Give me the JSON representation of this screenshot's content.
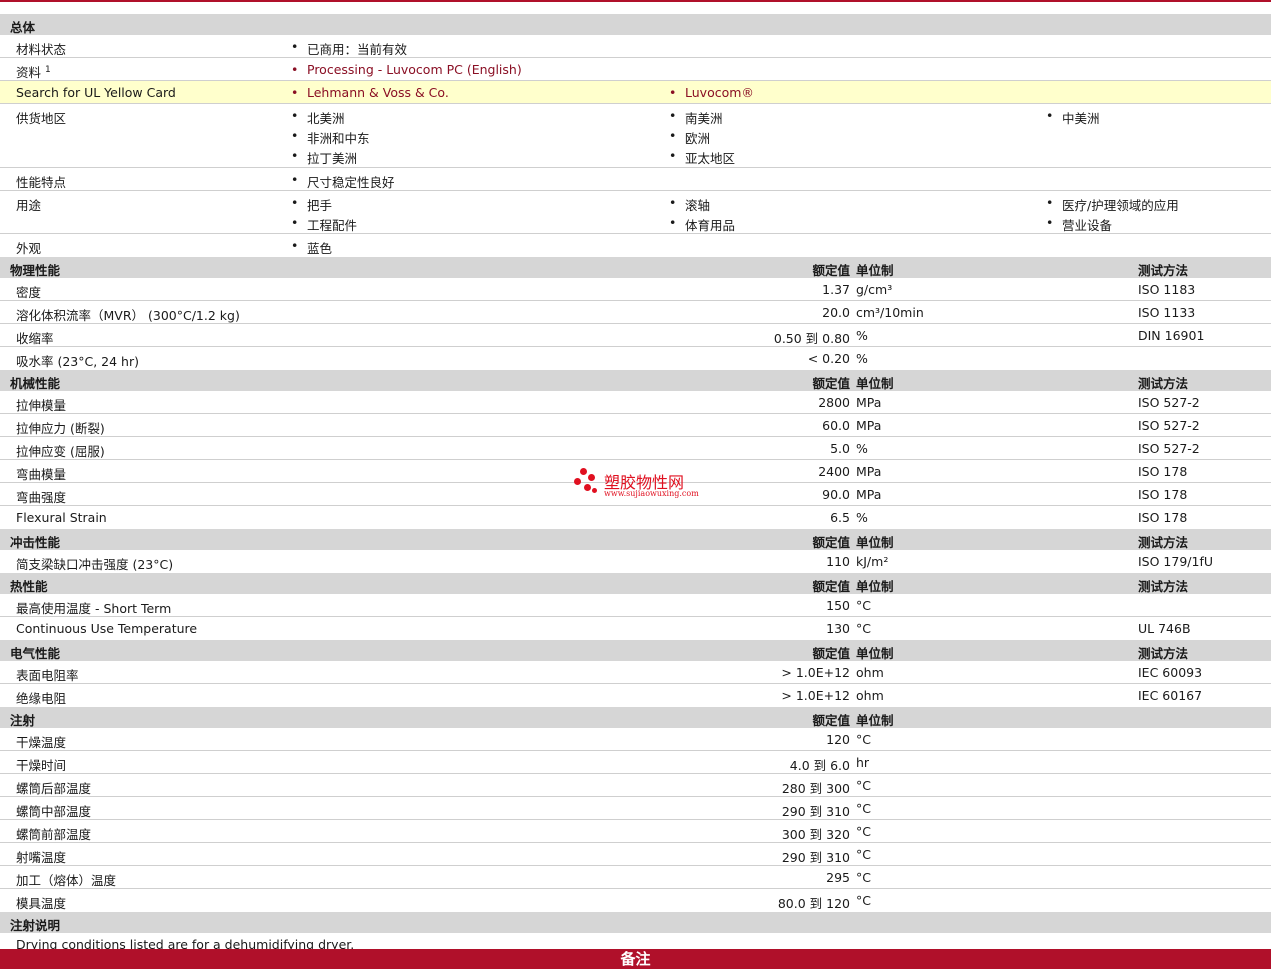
{
  "general": {
    "title": "总体",
    "material_status": {
      "label": "材料状态",
      "value": "已商用：当前有效"
    },
    "documents": {
      "label": "资料",
      "sup": "1",
      "value": "Processing - Luvocom PC (English)"
    },
    "ul": {
      "label": "Search for UL Yellow Card",
      "items": [
        "Lehmann & Voss & Co.",
        "Luvocom®"
      ]
    },
    "regions": {
      "label": "供货地区",
      "items": [
        "北美洲",
        "南美洲",
        "中美洲",
        "非洲和中东",
        "欧洲",
        "拉丁美洲",
        "亚太地区"
      ]
    },
    "features": {
      "label": "性能特点",
      "items": [
        "尺寸稳定性良好"
      ]
    },
    "uses": {
      "label": "用途",
      "items": [
        "把手",
        "滚轴",
        "医疗/护理领域的应用",
        "工程配件",
        "体育用品",
        "营业设备"
      ]
    },
    "appearance": {
      "label": "外观",
      "items": [
        "蓝色"
      ]
    }
  },
  "headers": {
    "nominal": "额定值",
    "unit": "单位制",
    "method": "测试方法"
  },
  "physical": {
    "title": "物理性能",
    "rows": [
      {
        "label": "密度",
        "value": "1.37",
        "unit": "g/cm³",
        "method": "ISO 1183"
      },
      {
        "label": "溶化体积流率（MVR） (300°C/1.2 kg)",
        "value": "20.0",
        "unit": "cm³/10min",
        "method": "ISO 1133"
      },
      {
        "label": "收缩率",
        "value": "0.50 到  0.80",
        "unit": "%",
        "method": "DIN 16901"
      },
      {
        "label": "吸水率 (23°C, 24 hr)",
        "value": "< 0.20",
        "unit": "%",
        "method": ""
      }
    ]
  },
  "mechanical": {
    "title": "机械性能",
    "rows": [
      {
        "label": "拉伸模量",
        "value": "2800",
        "unit": "MPa",
        "method": "ISO 527-2"
      },
      {
        "label": "拉伸应力 (断裂)",
        "value": "60.0",
        "unit": "MPa",
        "method": "ISO 527-2"
      },
      {
        "label": "拉伸应变 (屈服)",
        "value": "5.0",
        "unit": "%",
        "method": "ISO 527-2"
      },
      {
        "label": "弯曲模量",
        "value": "2400",
        "unit": "MPa",
        "method": "ISO 178"
      },
      {
        "label": "弯曲强度",
        "value": "90.0",
        "unit": "MPa",
        "method": "ISO 178"
      },
      {
        "label": "Flexural Strain",
        "value": "6.5",
        "unit": "%",
        "method": "ISO 178"
      }
    ]
  },
  "impact": {
    "title": "冲击性能",
    "rows": [
      {
        "label": "简支梁缺口冲击强度 (23°C)",
        "value": "110",
        "unit": "kJ/m²",
        "method": "ISO 179/1fU"
      }
    ]
  },
  "thermal": {
    "title": "热性能",
    "rows": [
      {
        "label": "最高使用温度  - Short Term",
        "value": "150",
        "unit": "°C",
        "method": ""
      },
      {
        "label": "Continuous Use Temperature",
        "value": "130",
        "unit": "°C",
        "method": "UL 746B"
      }
    ]
  },
  "electrical": {
    "title": "电气性能",
    "rows": [
      {
        "label": "表面电阻率",
        "value": "> 1.0E+12",
        "unit": "ohm",
        "method": "IEC 60093"
      },
      {
        "label": "绝缘电阻",
        "value": "> 1.0E+12",
        "unit": "ohm",
        "method": "IEC 60167"
      }
    ]
  },
  "injection": {
    "title": "注射",
    "rows": [
      {
        "label": "干燥温度",
        "value": "120",
        "unit": "°C"
      },
      {
        "label": "干燥时间",
        "value": "4.0 到  6.0",
        "unit": "hr"
      },
      {
        "label": "螺筒后部温度",
        "value": "280 到  300",
        "unit": "°C"
      },
      {
        "label": "螺筒中部温度",
        "value": "290 到  310",
        "unit": "°C"
      },
      {
        "label": "螺筒前部温度",
        "value": "300 到  320",
        "unit": "°C"
      },
      {
        "label": "射嘴温度",
        "value": "290 到  310",
        "unit": "°C"
      },
      {
        "label": "加工（熔体）温度",
        "value": "295",
        "unit": "°C"
      },
      {
        "label": "模具温度",
        "value": "80.0 到  120",
        "unit": "°C"
      }
    ]
  },
  "injection_notes": {
    "title": "注射说明",
    "text": "Drying conditions listed are for a dehumidifying dryer."
  },
  "footer": {
    "title": "备注"
  },
  "watermark": {
    "text": "塑胶物性网",
    "url": "www.sujiaowuxing.com"
  },
  "colors": {
    "accent": "#b0102a",
    "link": "#8a0f24",
    "highlight": "#ffffcc",
    "section": "#d6d6d6"
  }
}
